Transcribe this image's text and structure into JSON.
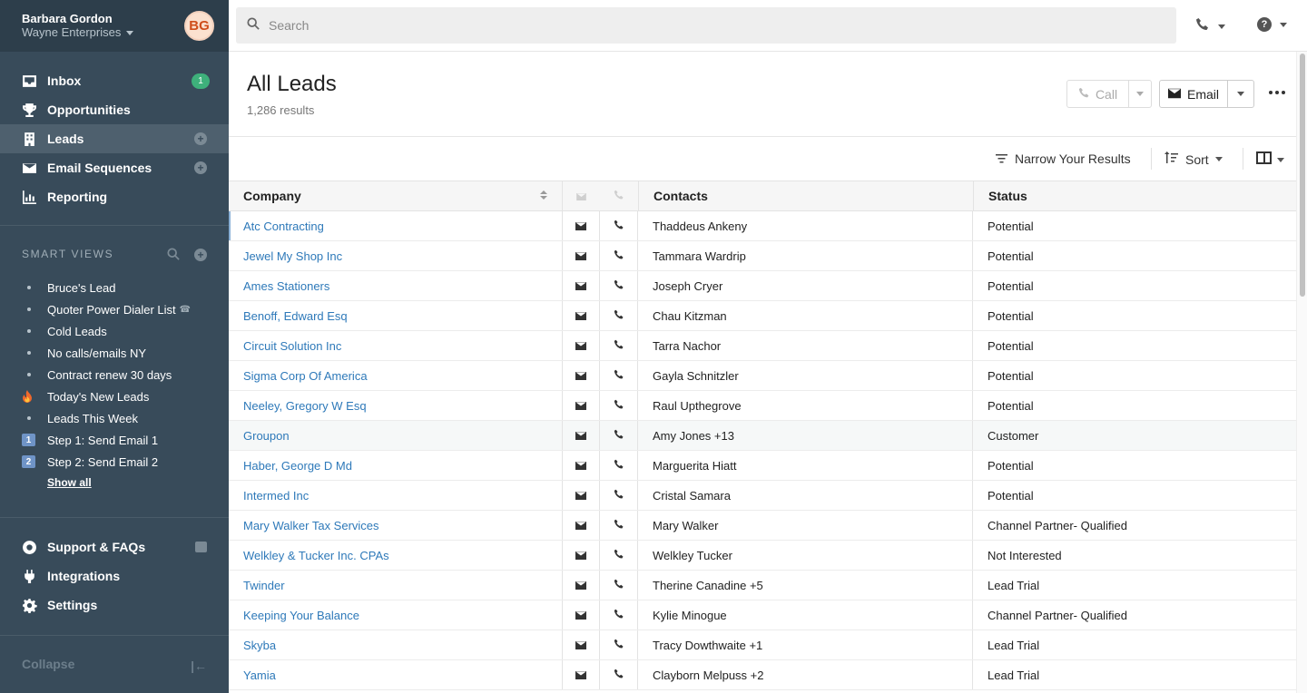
{
  "user": {
    "name": "Barbara Gordon",
    "org": "Wayne Enterprises",
    "initials": "BG"
  },
  "nav": {
    "inbox": {
      "label": "Inbox",
      "badge": "1"
    },
    "opportunities": {
      "label": "Opportunities"
    },
    "leads": {
      "label": "Leads"
    },
    "email_sequences": {
      "label": "Email Sequences"
    },
    "reporting": {
      "label": "Reporting"
    }
  },
  "smart_views": {
    "header": "SMART VIEWS",
    "items": [
      {
        "label": "Bruce's Lead",
        "marker": "bullet"
      },
      {
        "label": "Quoter Power Dialer List",
        "marker": "bullet",
        "suffix": "☎"
      },
      {
        "label": "Cold Leads",
        "marker": "bullet"
      },
      {
        "label": "No calls/emails NY",
        "marker": "bullet"
      },
      {
        "label": "Contract renew 30 days",
        "marker": "bullet"
      },
      {
        "label": "Today's New Leads",
        "marker": "fire"
      },
      {
        "label": "Leads This Week",
        "marker": "bullet"
      },
      {
        "label": "Step 1: Send Email 1",
        "marker": "1"
      },
      {
        "label": "Step 2: Send Email 2",
        "marker": "2"
      }
    ],
    "show_all": "Show all"
  },
  "bottom_nav": {
    "support": "Support & FAQs",
    "integrations": "Integrations",
    "settings": "Settings",
    "collapse": "Collapse"
  },
  "search": {
    "placeholder": "Search"
  },
  "header": {
    "title": "All Leads",
    "results": "1,286 results",
    "call_label": "Call",
    "email_label": "Email"
  },
  "toolbar": {
    "narrow": "Narrow Your Results",
    "sort": "Sort"
  },
  "table": {
    "columns": {
      "company": "Company",
      "contacts": "Contacts",
      "status": "Status"
    },
    "rows": [
      {
        "company": "Atc Contracting",
        "contacts": "Thaddeus Ankeny",
        "status": "Potential"
      },
      {
        "company": "Jewel My Shop Inc",
        "contacts": "Tammara Wardrip",
        "status": "Potential"
      },
      {
        "company": "Ames Stationers",
        "contacts": "Joseph Cryer",
        "status": "Potential"
      },
      {
        "company": "Benoff, Edward Esq",
        "contacts": "Chau Kitzman",
        "status": "Potential"
      },
      {
        "company": "Circuit Solution Inc",
        "contacts": "Tarra Nachor",
        "status": "Potential"
      },
      {
        "company": "Sigma Corp Of America",
        "contacts": "Gayla Schnitzler",
        "status": "Potential"
      },
      {
        "company": "Neeley, Gregory W Esq",
        "contacts": "Raul Upthegrove",
        "status": "Potential"
      },
      {
        "company": "Groupon",
        "contacts": "Amy Jones +13",
        "status": "Customer"
      },
      {
        "company": "Haber, George D Md",
        "contacts": "Marguerita Hiatt",
        "status": "Potential"
      },
      {
        "company": "Intermed Inc",
        "contacts": "Cristal Samara",
        "status": "Potential"
      },
      {
        "company": "Mary Walker Tax Services",
        "contacts": "Mary Walker",
        "status": "Channel Partner- Qualified"
      },
      {
        "company": "Welkley & Tucker Inc. CPAs",
        "contacts": "Welkley Tucker",
        "status": "Not Interested"
      },
      {
        "company": "Twinder",
        "contacts": "Therine Canadine +5",
        "status": "Lead Trial"
      },
      {
        "company": "Keeping Your Balance",
        "contacts": "Kylie Minogue",
        "status": "Channel Partner- Qualified"
      },
      {
        "company": "Skyba",
        "contacts": "Tracy Dowthwaite +1",
        "status": "Lead Trial"
      },
      {
        "company": "Yamia",
        "contacts": "Clayborn Melpuss +2",
        "status": "Lead Trial"
      }
    ],
    "highlighted_row": 7
  },
  "colors": {
    "sidebar": "#384b5a",
    "link": "#2e79b9",
    "badge": "#3eb07b"
  }
}
